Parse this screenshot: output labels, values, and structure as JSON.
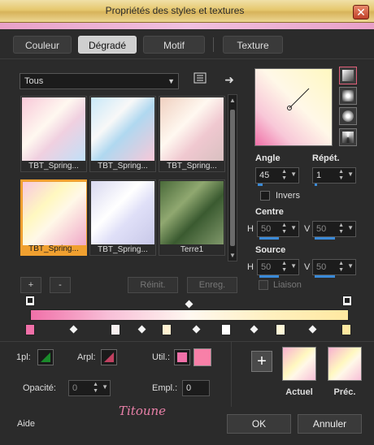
{
  "window": {
    "title": "Propriétés des styles et textures",
    "close": "✕"
  },
  "tabs": [
    {
      "label": "Couleur"
    },
    {
      "label": "Dégradé"
    },
    {
      "label": "Motif"
    },
    {
      "label": "Texture"
    }
  ],
  "category": {
    "value": "Tous"
  },
  "thumbnails": [
    {
      "caption": "TBT_Spring..."
    },
    {
      "caption": "TBT_Spring..."
    },
    {
      "caption": "TBT_Spring..."
    },
    {
      "caption": "TBT_Spring..."
    },
    {
      "caption": "TBT_Spring..."
    },
    {
      "caption": "Terre1"
    }
  ],
  "list_buttons": {
    "add": "+",
    "remove": "-",
    "reset": "Réinit.",
    "save": "Enreg."
  },
  "angle": {
    "label": "Angle",
    "value": "45"
  },
  "repeat": {
    "label": "Répét.",
    "value": "1"
  },
  "invert": {
    "label": "Invers"
  },
  "center": {
    "label": "Centre",
    "h_label": "H",
    "h_value": "50",
    "v_label": "V",
    "v_value": "50"
  },
  "source": {
    "label": "Source",
    "h_label": "H",
    "h_value": "50",
    "v_label": "V",
    "v_value": "50"
  },
  "link": {
    "label": "Liaison"
  },
  "stops_row": {
    "first_label": "1pl:",
    "arpl_label": "Arpl:",
    "util_label": "Util.:"
  },
  "opacity": {
    "label": "Opacité:",
    "value": "0"
  },
  "empl": {
    "label": "Empl.:",
    "value": "0"
  },
  "previews": {
    "current": "Actuel",
    "previous": "Préc.",
    "add": "+"
  },
  "footer": {
    "help": "Aide",
    "ok": "OK",
    "cancel": "Annuler",
    "watermark": "Titoune"
  },
  "colors": {
    "selection": "#f0a030",
    "accent": "#3a8ad8",
    "pink": "#f070a8"
  }
}
